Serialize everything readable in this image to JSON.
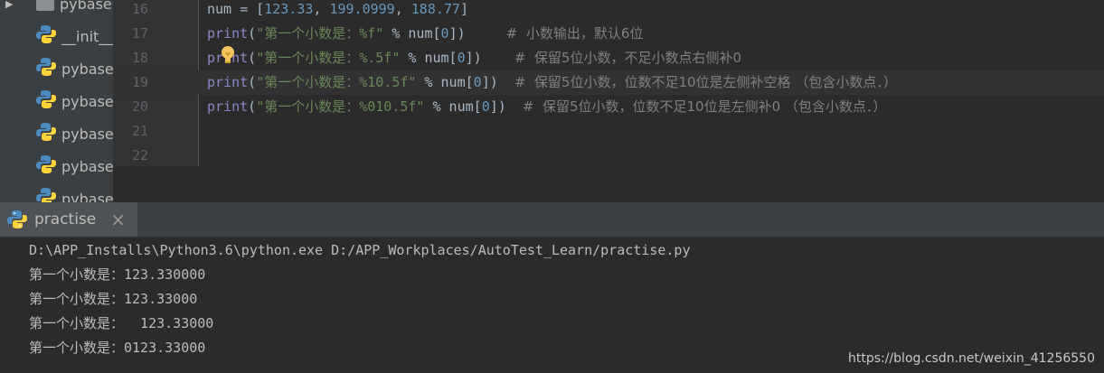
{
  "project_tree": {
    "items": [
      {
        "label": "pybase"
      },
      {
        "label": "__init__"
      },
      {
        "label": "pybase"
      },
      {
        "label": "pybase"
      },
      {
        "label": "pybase"
      },
      {
        "label": "pybase"
      },
      {
        "label": "pybase"
      }
    ]
  },
  "editor": {
    "lines": [
      {
        "num": "16",
        "segments": [
          {
            "t": "num = [",
            "c": "plain"
          },
          {
            "t": "123.33",
            "c": "num"
          },
          {
            "t": ", ",
            "c": "plain"
          },
          {
            "t": "199.0999",
            "c": "num"
          },
          {
            "t": ", ",
            "c": "plain"
          },
          {
            "t": "188.77",
            "c": "num"
          },
          {
            "t": "]",
            "c": "plain"
          }
        ]
      },
      {
        "num": "17",
        "segments": [
          {
            "t": "print",
            "c": "kw"
          },
          {
            "t": "(",
            "c": "plain"
          },
          {
            "t": "\"第一个小数是：%f\"",
            "c": "str"
          },
          {
            "t": " % num[",
            "c": "plain"
          },
          {
            "t": "0",
            "c": "num"
          },
          {
            "t": "])     ",
            "c": "plain"
          },
          {
            "t": "#  小数输出，默认6位",
            "c": "comment"
          }
        ]
      },
      {
        "num": "18",
        "segments": [
          {
            "t": "print",
            "c": "kw"
          },
          {
            "t": "(",
            "c": "plain"
          },
          {
            "t": "\"第一个小数是：%.5f\"",
            "c": "str"
          },
          {
            "t": " % num[",
            "c": "plain"
          },
          {
            "t": "0",
            "c": "num"
          },
          {
            "t": "])    ",
            "c": "plain"
          },
          {
            "t": "#  保留5位小数，不足小数点右侧补0",
            "c": "comment"
          }
        ]
      },
      {
        "num": "19",
        "active": true,
        "segments": [
          {
            "t": "print",
            "c": "kw"
          },
          {
            "t": "(",
            "c": "plain"
          },
          {
            "t": "\"第一个小数是：%10.5f\"",
            "c": "str"
          },
          {
            "t": " % num[",
            "c": "plain"
          },
          {
            "t": "0",
            "c": "num"
          },
          {
            "t": "])  ",
            "c": "plain"
          },
          {
            "t": "#  保留5位小数，位数不足10位是左侧补空格 （包含小数点．）",
            "c": "comment"
          }
        ]
      },
      {
        "num": "20",
        "segments": [
          {
            "t": "print",
            "c": "kw"
          },
          {
            "t": "(",
            "c": "plain"
          },
          {
            "t": "\"第一个小数是：%010.5f\"",
            "c": "str"
          },
          {
            "t": " % num[",
            "c": "plain"
          },
          {
            "t": "0",
            "c": "num"
          },
          {
            "t": "])  ",
            "c": "plain"
          },
          {
            "t": "#  保留5位小数，位数不足10位是左侧补0 （包含小数点．）",
            "c": "comment"
          }
        ]
      },
      {
        "num": "21",
        "segments": []
      },
      {
        "num": "22",
        "segments": []
      }
    ]
  },
  "run_panel": {
    "tab_label": "practise",
    "close_glyph": "×",
    "console_lines": [
      "D:\\APP_Installs\\Python3.6\\python.exe D:/APP_Workplaces/AutoTest_Learn/practise.py",
      "第一个小数是：123.330000",
      "第一个小数是：123.33000",
      "第一个小数是：  123.33000",
      "第一个小数是：0123.33000"
    ]
  },
  "watermark": "https://blog.csdn.net/weixin_41256550",
  "colors": {
    "editor_bg": "#2b2b2b",
    "panel_bg": "#3c3f41",
    "keyword": "#8888c6",
    "string": "#6a8759",
    "number": "#6897bb",
    "comment": "#808080"
  },
  "icons": {
    "python_file": "python-icon",
    "intention_bulb": "lightbulb-icon",
    "close": "close-icon",
    "expand": "triangle-right-icon"
  }
}
